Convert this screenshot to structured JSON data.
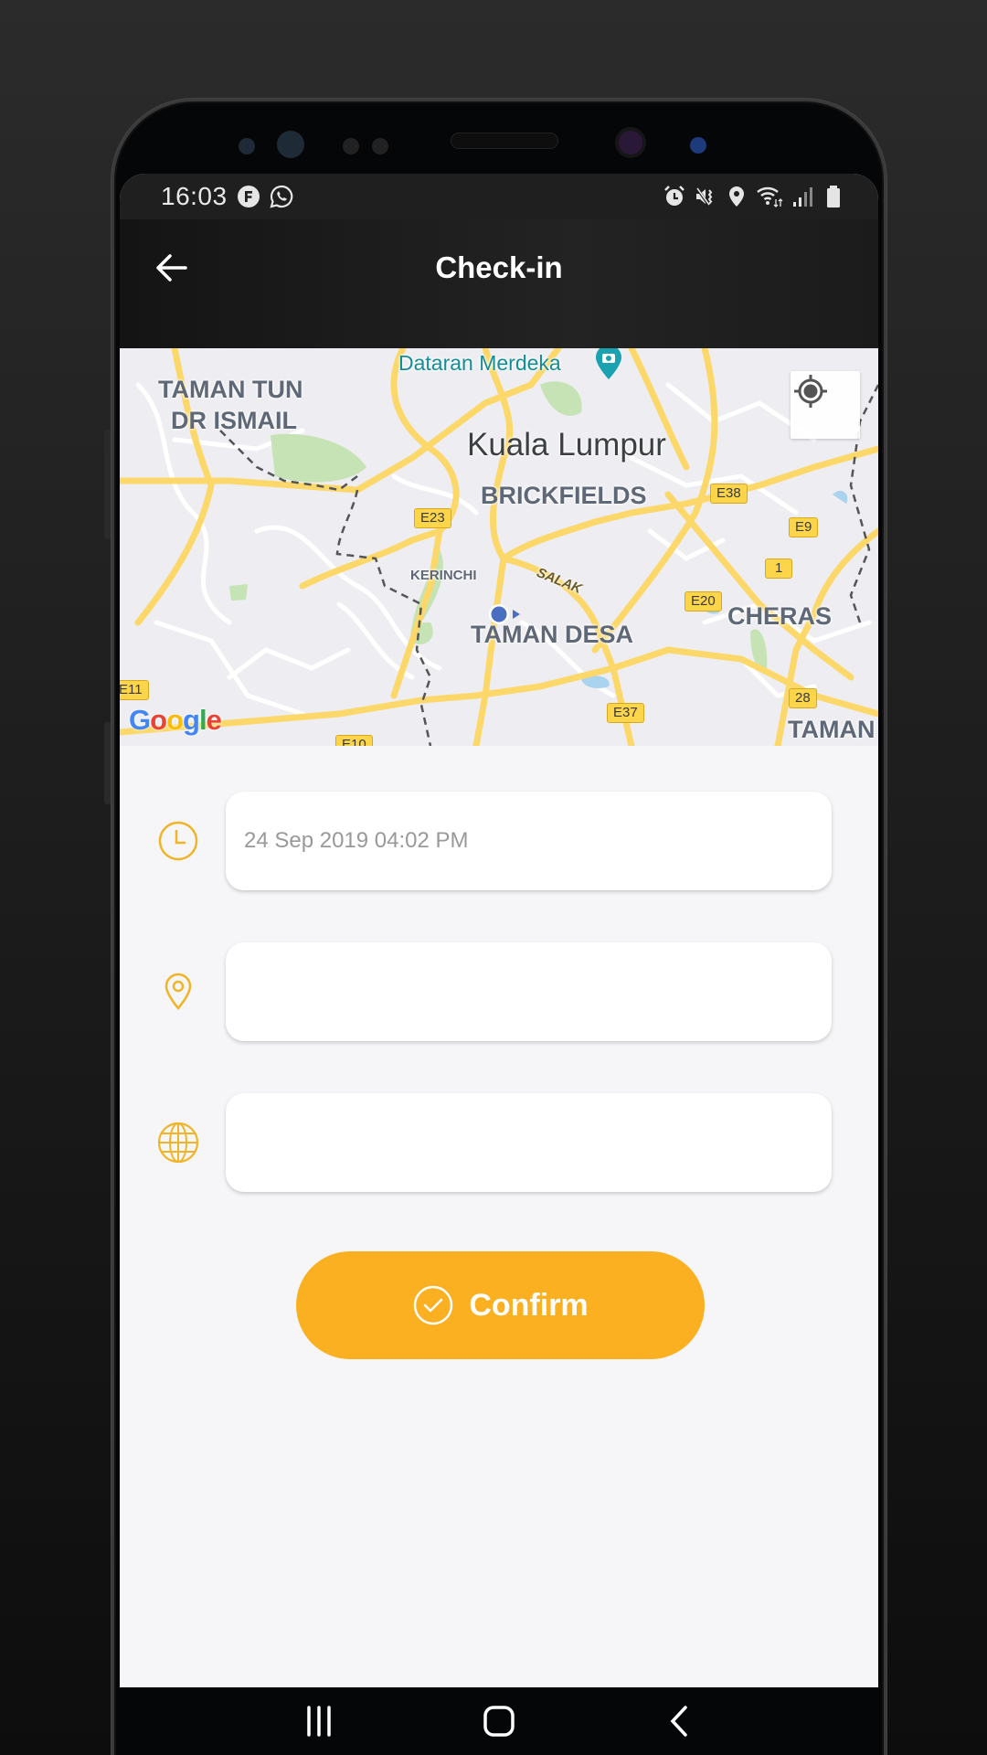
{
  "status_bar": {
    "time": "16:03",
    "notification_icons": [
      "flipboard-icon",
      "whatsapp-icon"
    ],
    "system_icons": [
      "alarm-icon",
      "vibrate-icon",
      "location-icon",
      "wifi-icon",
      "signal-icon",
      "battery-icon"
    ]
  },
  "header": {
    "title": "Check-in",
    "back_icon": "arrow-left-icon"
  },
  "map": {
    "labels": {
      "taman_tun": "TAMAN TUN",
      "dr_ismail": "DR ISMAIL",
      "dataran_merdeka": "Dataran Merdeka",
      "kuala_lumpur": "Kuala Lumpur",
      "brickfields": "BRICKFIELDS",
      "kerinchi": "KERINCHI",
      "salak": "SALAK",
      "taman_desa": "TAMAN DESA",
      "cheras": "CHERAS",
      "taman": "TAMAN"
    },
    "shields": {
      "e23": "E23",
      "e38": "E38",
      "e9": "E9",
      "r1": "1",
      "e20": "E20",
      "e37": "E37",
      "r28": "28",
      "e11": "E11",
      "e10": "E10"
    },
    "attribution": {
      "g1": "G",
      "o1": "o",
      "o2": "o",
      "g2": "g",
      "l": "l",
      "e": "e"
    },
    "colors": {
      "road": "#fcd86a",
      "park": "#c5e3b5",
      "water": "#aad3f0",
      "user_dot": "#4a6fc0"
    }
  },
  "form": {
    "datetime": {
      "icon": "clock-icon",
      "value": "24 Sep 2019 04:02 PM"
    },
    "location": {
      "icon": "map-pin-icon",
      "value": ""
    },
    "address": {
      "icon": "globe-icon",
      "value": ""
    }
  },
  "confirm_button": {
    "label": "Confirm",
    "icon": "check-circle-icon",
    "color": "#fbb022"
  },
  "accent_color": "#f0b429",
  "nav_bar": {
    "buttons": [
      "recents-icon",
      "home-icon",
      "back-icon"
    ]
  }
}
